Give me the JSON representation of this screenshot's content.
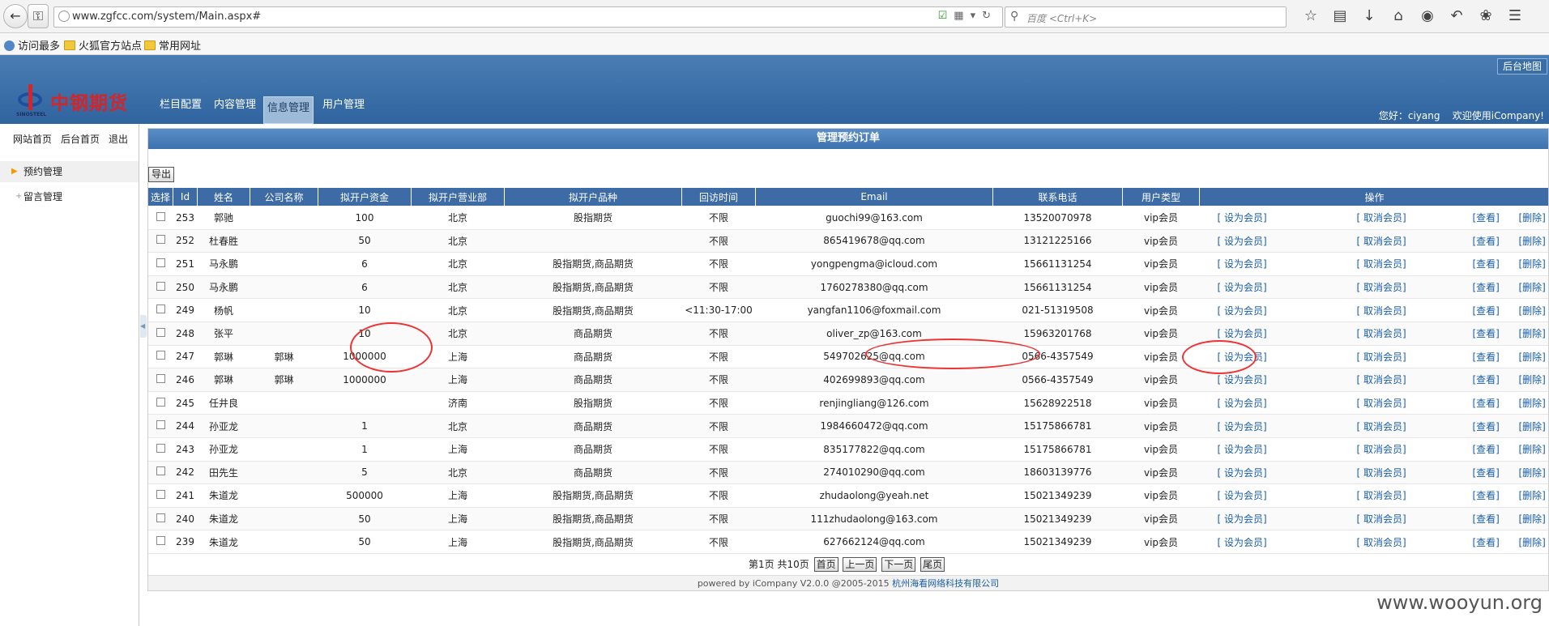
{
  "browser": {
    "url": "www.zgfcc.com/system/Main.aspx#",
    "search_placeholder": "百度 <Ctrl+K>",
    "bookmarks": [
      "访问最多",
      "火狐官方站点",
      "常用网址"
    ]
  },
  "header": {
    "logo_text": "中钢期货",
    "logo_sub": "SINOSTEEL",
    "site_map_button": "后台地图",
    "nav": [
      "栏目配置",
      "内容管理",
      "信息管理",
      "用户管理"
    ],
    "active_nav": "信息管理",
    "greeting": "您好：ciyang    欢迎使用iCompany!"
  },
  "sidebar": {
    "links": [
      "网站首页",
      "后台首页",
      "退出"
    ],
    "menu": [
      "预约管理",
      "留言管理"
    ]
  },
  "main": {
    "title": "管理预约订单",
    "export_label": "导出",
    "columns": [
      "选择",
      "Id",
      "姓名",
      "公司名称",
      "拟开户资金",
      "拟开户营业部",
      "拟开户品种",
      "回访时间",
      "Email",
      "联系电话",
      "用户类型",
      "操作"
    ],
    "actions": [
      "[ 设为会员]",
      "[ 取消会员]",
      "[查看]",
      "[删除]"
    ],
    "rows": [
      {
        "id": "253",
        "name": "郭驰",
        "company": "",
        "funds": "100",
        "branch": "北京",
        "product": "股指期货",
        "callback": "不限",
        "email": "guochi99@163.com",
        "phone": "13520070978",
        "type": "vip会员"
      },
      {
        "id": "252",
        "name": "杜春胜",
        "company": "",
        "funds": "50",
        "branch": "北京",
        "product": "",
        "callback": "不限",
        "email": "865419678@qq.com",
        "phone": "13121225166",
        "type": "vip会员"
      },
      {
        "id": "251",
        "name": "马永鹏",
        "company": "",
        "funds": "6",
        "branch": "北京",
        "product": "股指期货,商品期货",
        "callback": "不限",
        "email": "yongpengma@icloud.com",
        "phone": "15661131254",
        "type": "vip会员"
      },
      {
        "id": "250",
        "name": "马永鹏",
        "company": "",
        "funds": "6",
        "branch": "北京",
        "product": "股指期货,商品期货",
        "callback": "不限",
        "email": "1760278380@qq.com",
        "phone": "15661131254",
        "type": "vip会员"
      },
      {
        "id": "249",
        "name": "杨帆",
        "company": "",
        "funds": "10",
        "branch": "北京",
        "product": "股指期货,商品期货",
        "callback": "<11:30-17:00",
        "email": "yangfan1106@foxmail.com",
        "phone": "021-51319508",
        "type": "vip会员"
      },
      {
        "id": "248",
        "name": "张平",
        "company": "",
        "funds": "10",
        "branch": "北京",
        "product": "商品期货",
        "callback": "不限",
        "email": "oliver_zp@163.com",
        "phone": "15963201768",
        "type": "vip会员"
      },
      {
        "id": "247",
        "name": "郭琳",
        "company": "郭琳",
        "funds": "1000000",
        "branch": "上海",
        "product": "商品期货",
        "callback": "不限",
        "email": "549702625@qq.com",
        "phone": "0566-4357549",
        "type": "vip会员"
      },
      {
        "id": "246",
        "name": "郭琳",
        "company": "郭琳",
        "funds": "1000000",
        "branch": "上海",
        "product": "商品期货",
        "callback": "不限",
        "email": "402699893@qq.com",
        "phone": "0566-4357549",
        "type": "vip会员"
      },
      {
        "id": "245",
        "name": "任井良",
        "company": "",
        "funds": "",
        "branch": "济南",
        "product": "股指期货",
        "callback": "不限",
        "email": "renjingliang@126.com",
        "phone": "15628922518",
        "type": "vip会员"
      },
      {
        "id": "244",
        "name": "孙亚龙",
        "company": "",
        "funds": "1",
        "branch": "北京",
        "product": "商品期货",
        "callback": "不限",
        "email": "1984660472@qq.com",
        "phone": "15175866781",
        "type": "vip会员"
      },
      {
        "id": "243",
        "name": "孙亚龙",
        "company": "",
        "funds": "1",
        "branch": "上海",
        "product": "商品期货",
        "callback": "不限",
        "email": "835177822@qq.com",
        "phone": "15175866781",
        "type": "vip会员"
      },
      {
        "id": "242",
        "name": "田先生",
        "company": "",
        "funds": "5",
        "branch": "北京",
        "product": "商品期货",
        "callback": "不限",
        "email": "274010290@qq.com",
        "phone": "18603139776",
        "type": "vip会员"
      },
      {
        "id": "241",
        "name": "朱道龙",
        "company": "",
        "funds": "500000",
        "branch": "上海",
        "product": "股指期货,商品期货",
        "callback": "不限",
        "email": "zhudaolong@yeah.net",
        "phone": "15021349239",
        "type": "vip会员"
      },
      {
        "id": "240",
        "name": "朱道龙",
        "company": "",
        "funds": "50",
        "branch": "上海",
        "product": "股指期货,商品期货",
        "callback": "不限",
        "email": "111zhudaolong@163.com",
        "phone": "15021349239",
        "type": "vip会员"
      },
      {
        "id": "239",
        "name": "朱道龙",
        "company": "",
        "funds": "50",
        "branch": "上海",
        "product": "股指期货,商品期货",
        "callback": "不限",
        "email": "627662124@qq.com",
        "phone": "15021349239",
        "type": "vip会员"
      }
    ]
  },
  "pager": {
    "info": "第1页 共10页",
    "first": "首页",
    "prev": "上一页",
    "next": "下一页",
    "last": "尾页"
  },
  "footer": {
    "text": "powered by iCompany V2.0.0 @2005-2015 ",
    "company": "杭州海看网络科技有限公司"
  },
  "watermark": "www.wooyun.org",
  "colors": {
    "header_blue": "#2f649f",
    "table_header": "#3c6ba6",
    "link": "#1a5ea8",
    "logo_red": "#d2262a",
    "annotation_red": "#ee3333"
  }
}
